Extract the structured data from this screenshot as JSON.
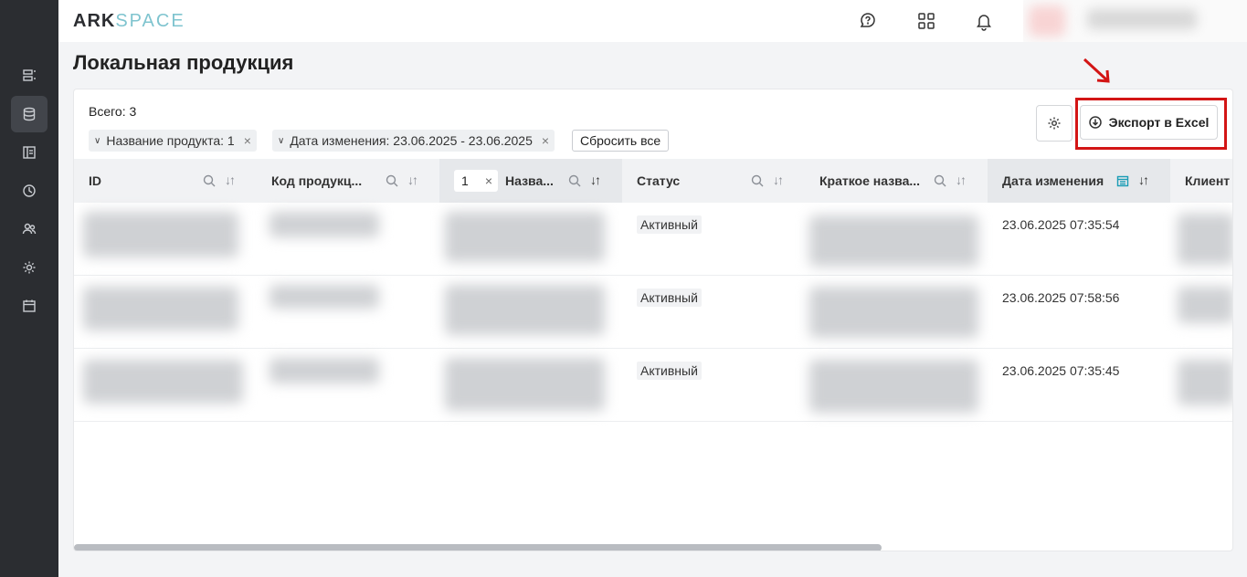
{
  "app": {
    "logo_ark": "ARK",
    "logo_space": "SPACE"
  },
  "sidebar": {
    "items": [
      {
        "icon": "list-icon"
      },
      {
        "icon": "database-icon",
        "active": true
      },
      {
        "icon": "layout-icon"
      },
      {
        "icon": "clock-icon"
      },
      {
        "icon": "users-icon"
      },
      {
        "icon": "gear-icon"
      },
      {
        "icon": "calendar-icon"
      }
    ]
  },
  "header": {
    "icons": [
      "help-chat-icon",
      "apps-grid-icon",
      "bell-icon"
    ]
  },
  "page": {
    "title": "Локальная продукция"
  },
  "summary": {
    "total": "Всего: 3"
  },
  "filters": [
    {
      "label": "Название продукта: 1"
    },
    {
      "label": "Дата изменения: 23.06.2025 - 23.06.2025"
    }
  ],
  "toolbar": {
    "reset_label": "Сбросить все",
    "export_label": "Экспорт в Excel"
  },
  "table": {
    "columns": [
      {
        "label": "ID"
      },
      {
        "label": "Код продукц..."
      },
      {
        "label": "Назва...",
        "filter_value": "1"
      },
      {
        "label": "Статус"
      },
      {
        "label": "Краткое назва..."
      },
      {
        "label": "Дата изменения"
      },
      {
        "label": "Клиент"
      }
    ],
    "rows": [
      {
        "status": "Активный",
        "date": "23.06.2025 07:35:54"
      },
      {
        "status": "Активный",
        "date": "23.06.2025 07:58:56"
      },
      {
        "status": "Активный",
        "date": "23.06.2025 07:35:45"
      }
    ]
  },
  "colors": {
    "accent": "#7fc4cf",
    "highlight": "#d31515",
    "rail": "#2b2d31"
  }
}
